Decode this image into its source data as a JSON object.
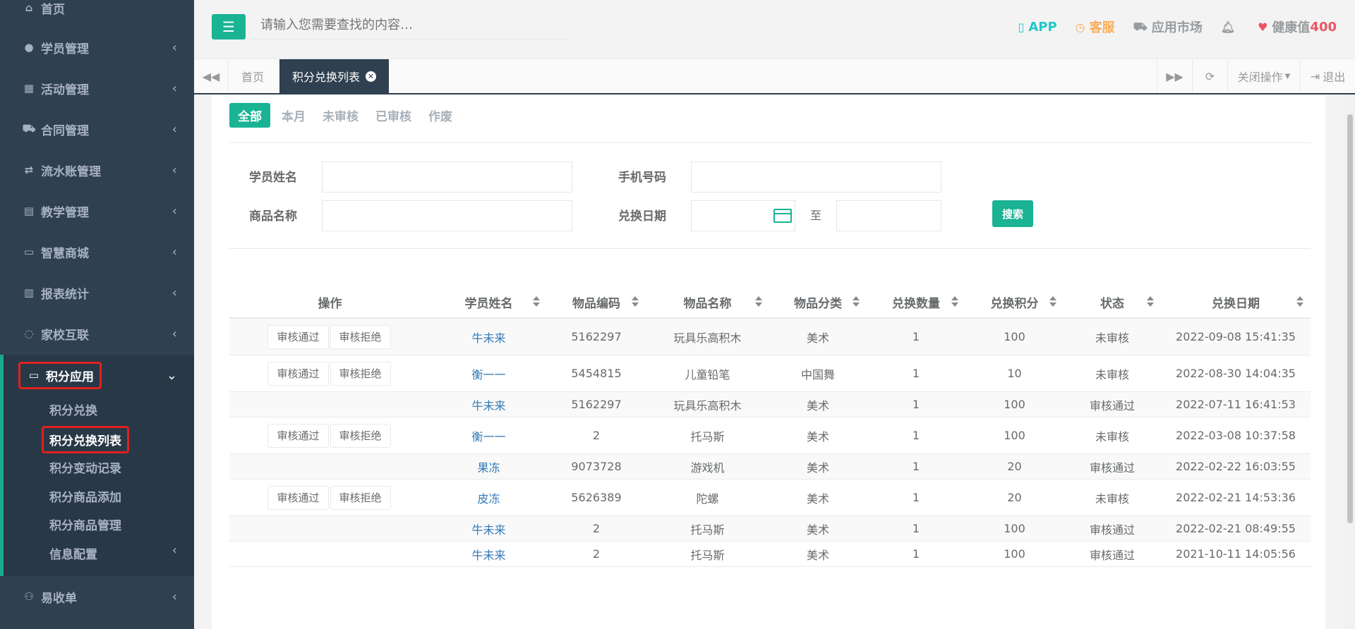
{
  "sidebar": {
    "top_item": {
      "label": "首页"
    },
    "items": [
      {
        "label": "学员管理"
      },
      {
        "label": "活动管理"
      },
      {
        "label": "合同管理"
      },
      {
        "label": "流水账管理"
      },
      {
        "label": "教学管理"
      },
      {
        "label": "智慧商城"
      },
      {
        "label": "报表统计"
      },
      {
        "label": "家校互联"
      }
    ],
    "active_item": {
      "label": "积分应用"
    },
    "sub_items": [
      {
        "label": "积分兑换"
      },
      {
        "label": "积分兑换列表"
      },
      {
        "label": "积分变动记录"
      },
      {
        "label": "积分商品添加"
      },
      {
        "label": "积分商品管理"
      },
      {
        "label": "信息配置"
      }
    ],
    "bottom_item": {
      "label": "易收单"
    }
  },
  "topbar": {
    "search_placeholder": "请输入您需要查找的内容…",
    "app": "APP",
    "service": "客服",
    "market": "应用市场",
    "health_label": "健康值",
    "health_value": "400"
  },
  "tabs": {
    "home": "首页",
    "current": "积分兑换列表",
    "close_ops": "关闭操作",
    "logout": "退出"
  },
  "filters": {
    "tabs": [
      "全部",
      "本月",
      "未审核",
      "已审核",
      "作废"
    ],
    "student_name_label": "学员姓名",
    "phone_label": "手机号码",
    "product_name_label": "商品名称",
    "exchange_date_label": "兑换日期",
    "to_label": "至",
    "search_btn": "搜索"
  },
  "table": {
    "headers": [
      "操作",
      "学员姓名",
      "物品编码",
      "物品名称",
      "物品分类",
      "兑换数量",
      "兑换积分",
      "状态",
      "兑换日期"
    ],
    "approve_label": "审核通过",
    "reject_label": "审核拒绝",
    "rows": [
      {
        "actions": true,
        "name": "牛未来",
        "code": "5162297",
        "item": "玩具乐高积木",
        "category": "美术",
        "qty": "1",
        "points": "100",
        "status": "未审核",
        "date": "2022-09-08 15:41:35"
      },
      {
        "actions": true,
        "name": "衡一一",
        "code": "5454815",
        "item": "儿童铅笔",
        "category": "中国舞",
        "qty": "1",
        "points": "10",
        "status": "未审核",
        "date": "2022-08-30 14:04:35"
      },
      {
        "actions": false,
        "name": "牛未来",
        "code": "5162297",
        "item": "玩具乐高积木",
        "category": "美术",
        "qty": "1",
        "points": "100",
        "status": "审核通过",
        "date": "2022-07-11 16:41:53"
      },
      {
        "actions": true,
        "name": "衡一一",
        "code": "2",
        "item": "托马斯",
        "category": "美术",
        "qty": "1",
        "points": "100",
        "status": "未审核",
        "date": "2022-03-08 10:37:58"
      },
      {
        "actions": false,
        "name": "果冻",
        "code": "9073728",
        "item": "游戏机",
        "category": "美术",
        "qty": "1",
        "points": "20",
        "status": "审核通过",
        "date": "2022-02-22 16:03:55"
      },
      {
        "actions": true,
        "name": "皮冻",
        "code": "5626389",
        "item": "陀螺",
        "category": "美术",
        "qty": "1",
        "points": "20",
        "status": "未审核",
        "date": "2022-02-21 14:53:36"
      },
      {
        "actions": false,
        "name": "牛未来",
        "code": "2",
        "item": "托马斯",
        "category": "美术",
        "qty": "1",
        "points": "100",
        "status": "审核通过",
        "date": "2022-02-21 08:49:55"
      },
      {
        "actions": false,
        "name": "牛未来",
        "code": "2",
        "item": "托马斯",
        "category": "美术",
        "qty": "1",
        "points": "100",
        "status": "审核通过",
        "date": "2021-10-11 14:05:56"
      }
    ]
  }
}
